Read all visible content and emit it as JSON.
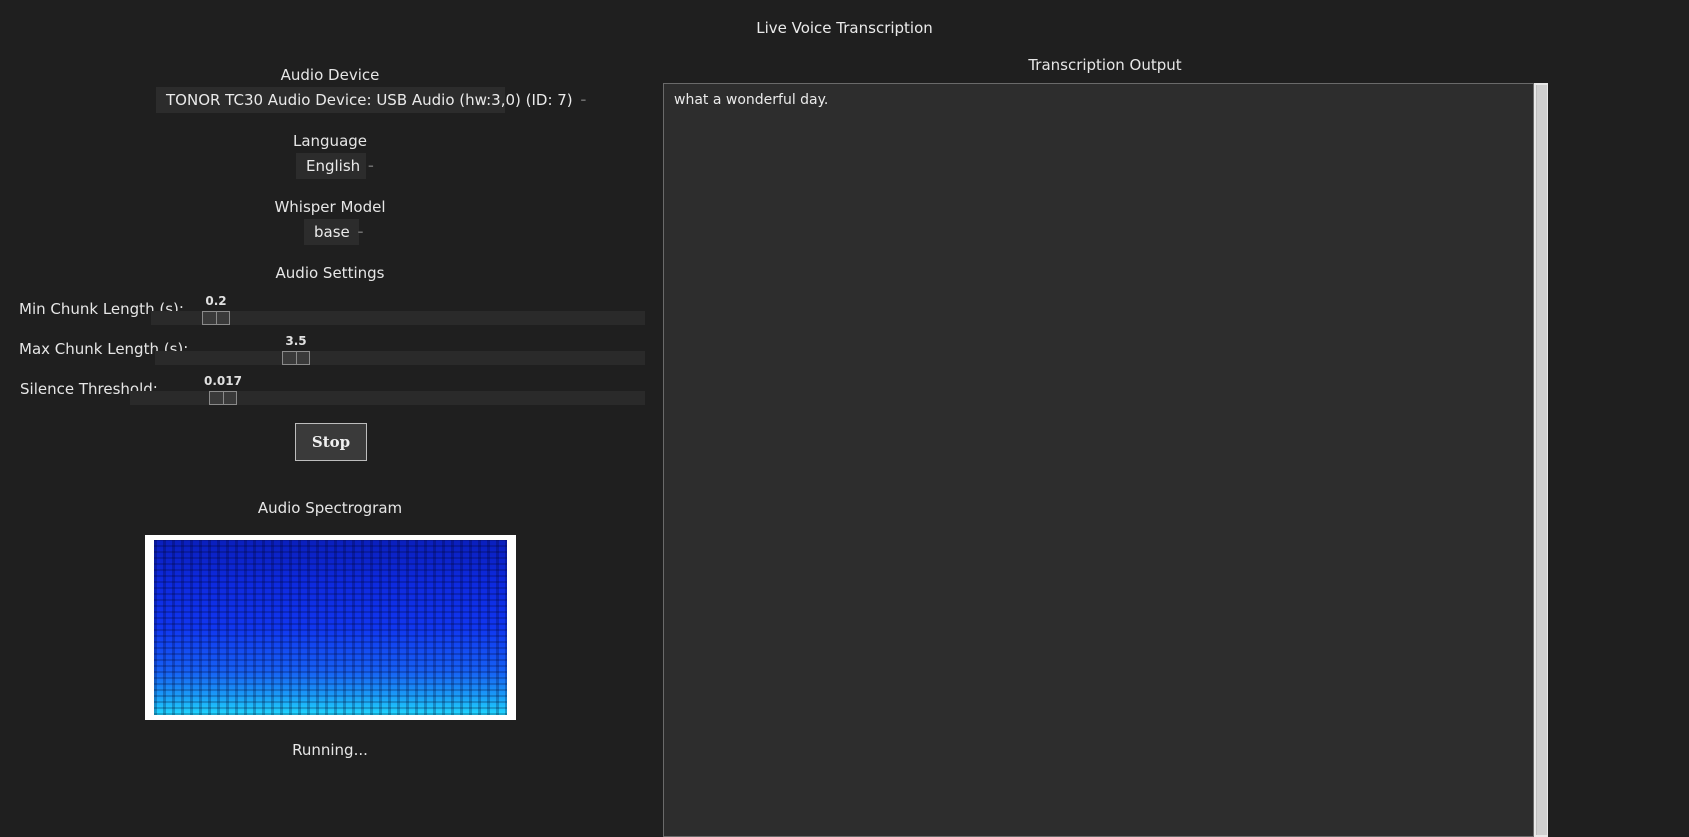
{
  "window": {
    "title": "Live Voice Transcription"
  },
  "device": {
    "label": "Audio Device",
    "value": "TONOR TC30 Audio Device: USB Audio (hw:3,0) (ID: 7)"
  },
  "language": {
    "label": "Language",
    "value": "English"
  },
  "model": {
    "label": "Whisper Model",
    "value": "base"
  },
  "audio_settings": {
    "label": "Audio Settings",
    "sliders": [
      {
        "label": "Min Chunk Length (s):",
        "value": "0.2"
      },
      {
        "label": "Max Chunk Length (s):",
        "value": "3.5"
      },
      {
        "label": "Silence Threshold:",
        "value": "0.017"
      }
    ]
  },
  "controls": {
    "stop_label": "Stop"
  },
  "spectrogram": {
    "label": "Audio Spectrogram"
  },
  "status": {
    "text": "Running..."
  },
  "output": {
    "label": "Transcription Output",
    "text": "what a wonderful day."
  }
}
